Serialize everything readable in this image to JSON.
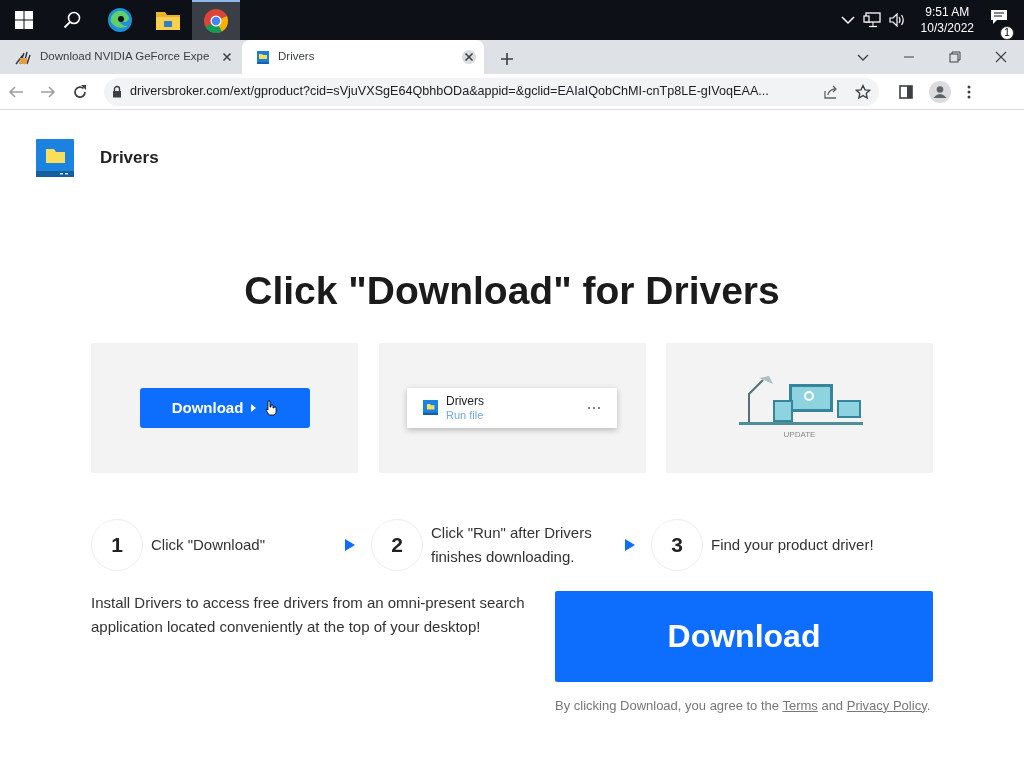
{
  "taskbar": {
    "apps": [
      {
        "kind": "edge",
        "selected": false
      },
      {
        "kind": "folder",
        "selected": false
      },
      {
        "kind": "chrome",
        "selected": true
      }
    ],
    "time": "9:51 AM",
    "date": "10/3/2022",
    "notifications": "1"
  },
  "tabs": [
    {
      "title": "Download NVIDIA GeForce Expe",
      "kind": "nvidia",
      "selected": false
    },
    {
      "title": "Drivers",
      "kind": "drive",
      "selected": true
    }
  ],
  "address": {
    "url": "driversbroker.com/ext/gproduct?cid=sVjuVXSgE64QbhbODa&appid=&gclid=EAIaIQobChMI-cnTp8LE-gIVoqEAA..."
  },
  "page": {
    "brand": "Drivers",
    "headline": "Click \"Download\" for Drivers",
    "panels": [
      {
        "kind": "button",
        "label": "Download"
      },
      {
        "kind": "file",
        "name": "Drivers",
        "action": "Run file"
      },
      {
        "kind": "illustration",
        "caption": "UPDATE"
      }
    ],
    "steps": [
      {
        "number": "1",
        "text": "Click \"Download\""
      },
      {
        "number": "2",
        "text": "Click \"Run\" after Drivers finishes downloading."
      },
      {
        "number": "3",
        "text": "Find your product driver!"
      }
    ],
    "description": "Install Drivers to access free drivers from an omni-present search application located conveniently at the top of your desktop!",
    "download_button": "Download",
    "legal": [
      {
        "kind": "text",
        "text": "By clicking Download, you agree to the "
      },
      {
        "kind": "link",
        "text": "Terms"
      },
      {
        "kind": "text",
        "text": " and "
      },
      {
        "kind": "link",
        "text": "Privacy Policy"
      },
      {
        "kind": "text",
        "text": "."
      }
    ]
  }
}
